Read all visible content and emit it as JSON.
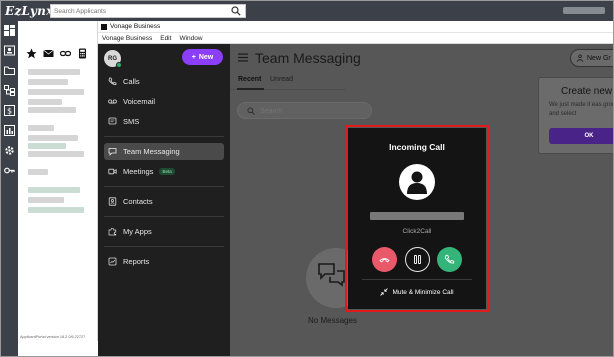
{
  "ezlynx": {
    "logo": "EzLynx",
    "search_placeholder": "Search Applicants",
    "version_text": "ApplicantPortal version 18.2.0/6.22727",
    "rail_icons": [
      "dashboard-icon",
      "contacts-card-icon",
      "folder-icon",
      "hierarchy-icon",
      "dollar-icon",
      "bar-chart-icon",
      "gear-icon",
      "key-icon"
    ],
    "panel_icons": [
      "star-icon",
      "mail-icon",
      "link-icon",
      "calculator-icon"
    ]
  },
  "vonage": {
    "window_title": "Vonage Business",
    "menu": [
      "Vonage Business",
      "Edit",
      "Window"
    ],
    "avatar_initials": "RG",
    "new_button": "New",
    "nav": [
      {
        "label": "Calls",
        "icon": "phone-icon"
      },
      {
        "label": "Voicemail",
        "icon": "voicemail-icon"
      },
      {
        "label": "SMS",
        "icon": "sms-icon"
      },
      {
        "label": "Team Messaging",
        "icon": "chat-icon",
        "active": true
      },
      {
        "label": "Meetings",
        "icon": "video-icon",
        "badge": "Beta"
      },
      {
        "label": "Contacts",
        "icon": "contacts-icon"
      },
      {
        "label": "My Apps",
        "icon": "puzzle-icon"
      },
      {
        "label": "Reports",
        "icon": "reports-icon"
      }
    ]
  },
  "team_messaging": {
    "title": "Team Messaging",
    "tabs": [
      "Recent",
      "Unread"
    ],
    "search_placeholder": "Search",
    "empty_text": "No Messages",
    "new_group_button": "New Gr",
    "promo": {
      "title": "Create new",
      "body": "We just made it eas groups and select",
      "ok": "OK"
    }
  },
  "incoming_call": {
    "title": "Incoming Call",
    "source": "Click2Call",
    "mute_label": "Mute & Minimize Call"
  },
  "colors": {
    "accent": "#8b3ffb",
    "decline": "#e8596a",
    "answer": "#35b47a",
    "highlight": "#e01b1b"
  }
}
